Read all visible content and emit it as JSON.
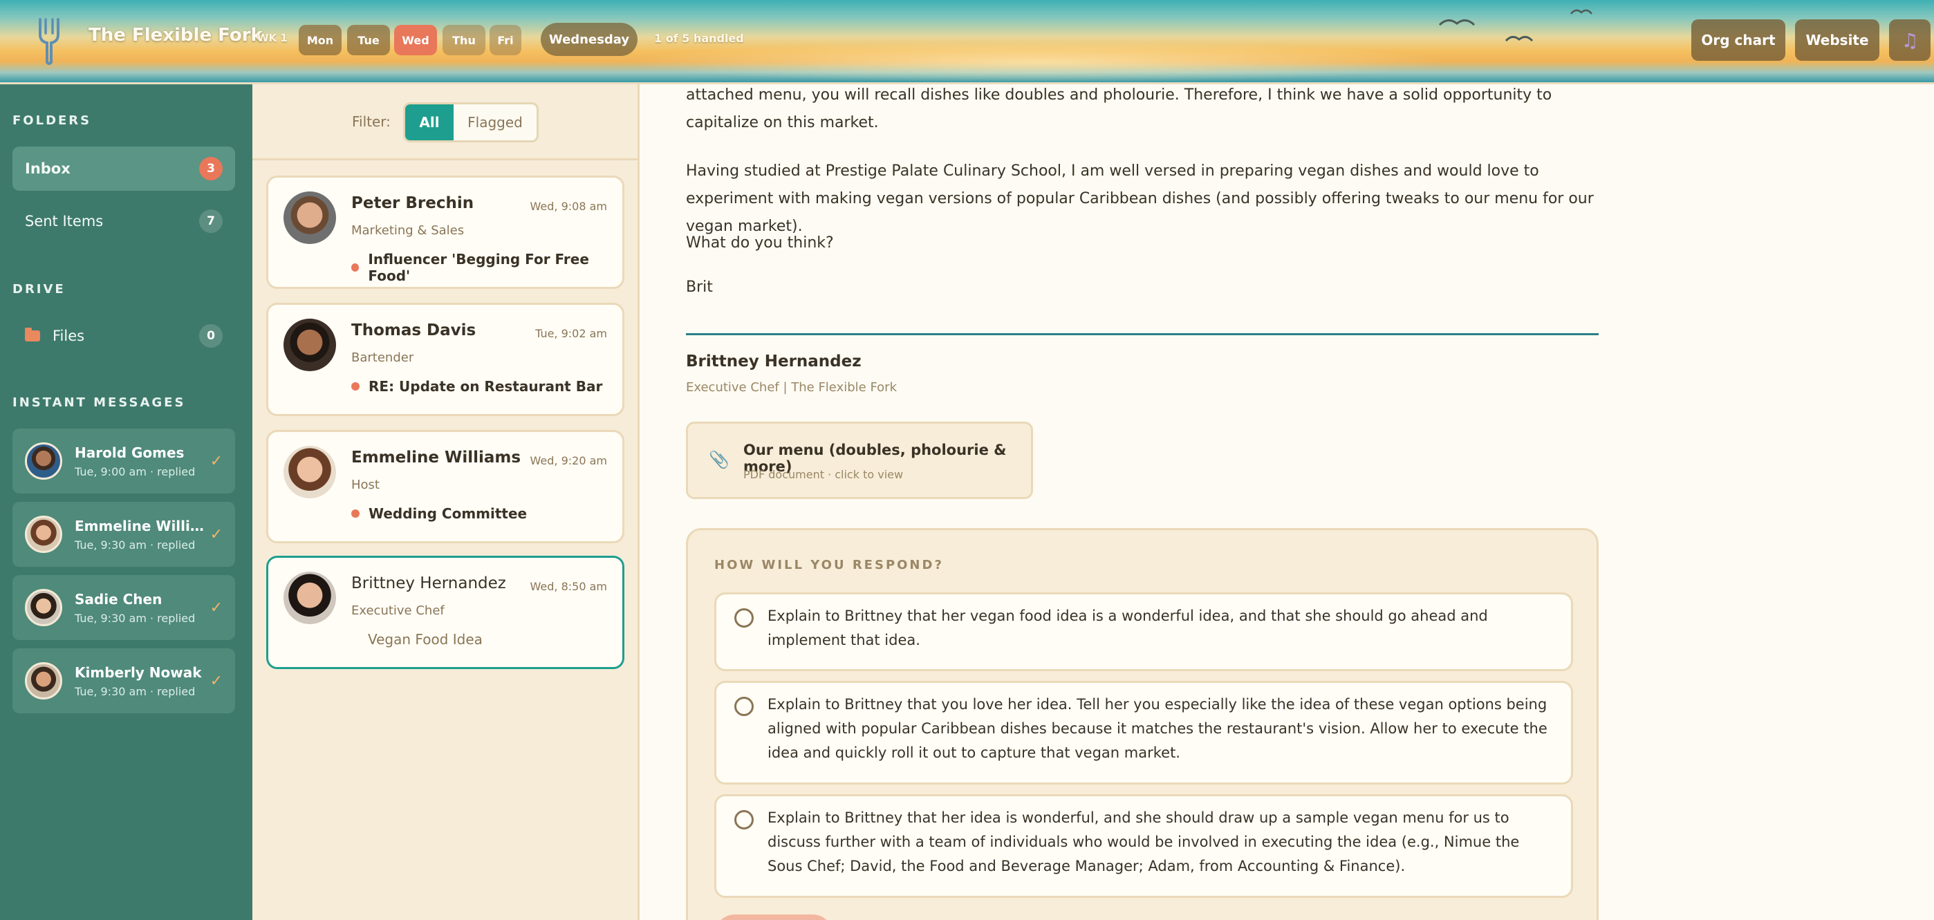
{
  "header": {
    "brand": "The Flexible Fork",
    "week": "WK 1",
    "days": [
      "Mon",
      "Tue",
      "Wed",
      "Thu",
      "Fri"
    ],
    "active_day": "Wed",
    "current_day": "Wednesday",
    "handled": "1 of 5 handled",
    "org_chart": "Org chart",
    "website": "Website",
    "music_icon": "music-note-icon"
  },
  "sidebar": {
    "folders_title": "FOLDERS",
    "folders": [
      {
        "label": "Inbox",
        "count": "3"
      },
      {
        "label": "Sent Items",
        "count": "7"
      }
    ],
    "drive_title": "DRIVE",
    "drive": {
      "label": "Files",
      "count": "0"
    },
    "im_title": "INSTANT MESSAGES",
    "messages": [
      {
        "name": "Harold Gomes",
        "meta": "Tue, 9:00 am · replied"
      },
      {
        "name": "Emmeline Williams",
        "meta": "Tue, 9:30 am · replied"
      },
      {
        "name": "Sadie Chen",
        "meta": "Tue, 9:30 am · replied"
      },
      {
        "name": "Kimberly Nowak",
        "meta": "Tue, 9:30 am · replied"
      }
    ]
  },
  "list": {
    "filter_label": "Filter:",
    "filter_all": "All",
    "filter_flagged": "Flagged",
    "emails": [
      {
        "from": "Peter Brechin",
        "time": "Wed, 9:08 am",
        "role": "Marketing & Sales",
        "subject": "Influencer 'Begging For Free Food'"
      },
      {
        "from": "Thomas Davis",
        "time": "Tue, 9:02 am",
        "role": "Bartender",
        "subject": "RE: Update on Restaurant Bar"
      },
      {
        "from": "Emmeline Williams",
        "time": "Wed, 9:20 am",
        "role": "Host",
        "subject": "Wedding Committee"
      },
      {
        "from": "Brittney Hernandez",
        "time": "Wed, 8:50 am",
        "role": "Executive Chef",
        "subject": "Vegan Food Idea"
      }
    ]
  },
  "pane": {
    "p1": "attached menu, you will recall dishes like doubles and pholourie. Therefore, I think we have a solid opportunity to capitalize on this market.",
    "p2": "Having studied at Prestige Palate Culinary School, I am well versed in preparing vegan dishes and would love to experiment with making vegan versions of popular Caribbean dishes (and possibly offering tweaks to our menu for our vegan market).",
    "p3": "What do you think?",
    "p4": "Brit",
    "sig_name": "Brittney Hernandez",
    "sig_role": "Executive Chef | The Flexible Fork",
    "attachment_title": "Our menu (doubles, pholourie & more)",
    "attachment_sub": "PDF document · click to view",
    "respond_title": "HOW WILL YOU RESPOND?",
    "options": [
      "Explain to Brittney that her vegan food idea is a wonderful idea, and that she should go ahead and implement that idea.",
      "Explain to Brittney that you love her idea. Tell her you especially like the idea of these vegan options being aligned with popular Caribbean dishes because it matches the restaurant's vision. Allow her to execute the idea and quickly roll it out to capture that vegan market.",
      "Explain to Brittney that her idea is wonderful, and she should draw up a sample vegan menu for us to discuss further with a team of individuals who would be involved in executing the idea (e.g., Nimue the Sous Chef; David, the Food and Beverage Manager; Adam, from Accounting & Finance)."
    ]
  },
  "colors": {
    "sidebar": "#3e7a6c",
    "accent_teal": "#1e9e8e",
    "accent_coral": "#e9775a",
    "list_bg": "#f6ecd8"
  }
}
